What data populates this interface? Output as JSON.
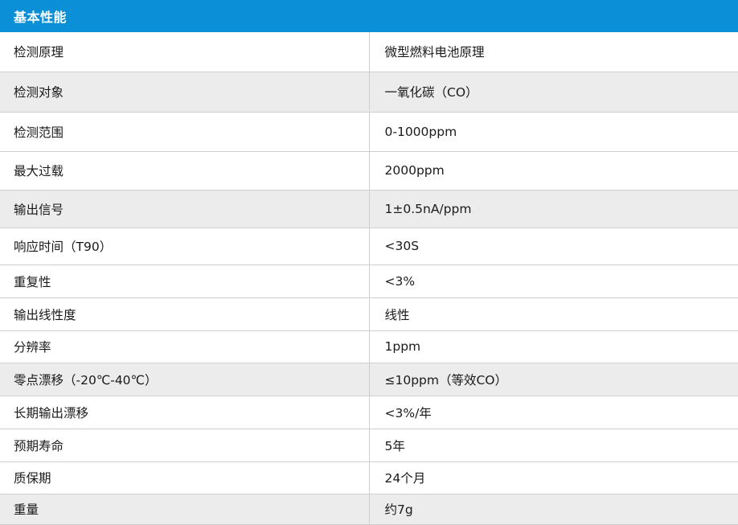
{
  "table": {
    "header": "基本性能",
    "rows": [
      {
        "label": "检测原理",
        "value": "微型燃料电池原理"
      },
      {
        "label": "检测对象",
        "value": "一氧化碳（CO）"
      },
      {
        "label": "检测范围",
        "value": "0-1000ppm"
      },
      {
        "label": "最大过载",
        "value": "2000ppm"
      },
      {
        "label": "输出信号",
        "value": "1±0.5nA/ppm"
      },
      {
        "label": "响应时间（T90）",
        "value": "<30S"
      },
      {
        "label": "重复性",
        "value": "<3%"
      },
      {
        "label": "输出线性度",
        "value": "线性"
      },
      {
        "label": "分辨率",
        "value": "1ppm"
      },
      {
        "label": "零点漂移（-20℃-40℃）",
        "value": "≤10ppm（等效CO）"
      },
      {
        "label": "长期输出漂移",
        "value": "<3%/年"
      },
      {
        "label": "预期寿命",
        "value": "5年"
      },
      {
        "label": "质保期",
        "value": "24个月"
      },
      {
        "label": "重量",
        "value": "约7g"
      }
    ]
  },
  "colors": {
    "header_bg": "#0b8fd6",
    "row_alt_bg": "#ececec",
    "border": "#cfcfcf"
  }
}
